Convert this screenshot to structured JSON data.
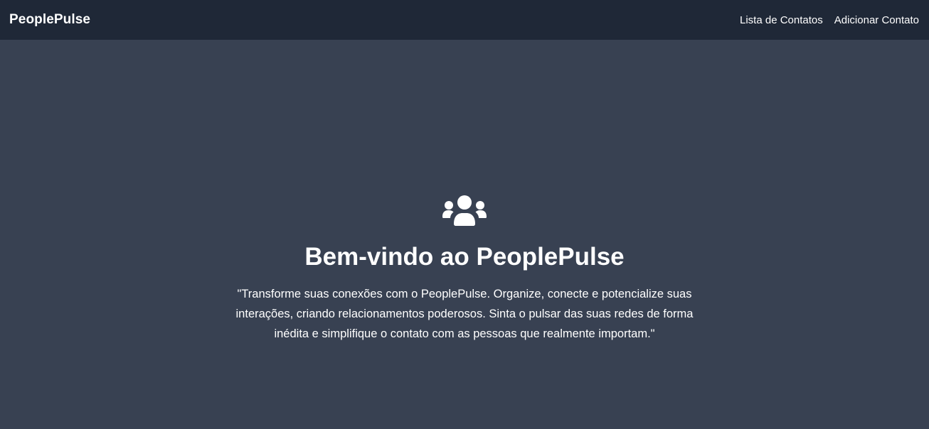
{
  "navbar": {
    "brand": "PeoplePulse",
    "links": [
      {
        "label": "Lista de Contatos"
      },
      {
        "label": "Adicionar Contato"
      }
    ]
  },
  "hero": {
    "icon": "users-icon",
    "title": "Bem-vindo ao PeoplePulse",
    "text": "\"Transforme suas conexões com o PeoplePulse. Organize, conecte e potencialize suas interações, criando relacionamentos poderosos. Sinta o pulsar das suas redes de forma inédita e simplifique o contato com as pessoas que realmente importam.\""
  },
  "colors": {
    "navbar_bg": "#1f2837",
    "page_bg": "#384152",
    "text": "#ffffff"
  }
}
